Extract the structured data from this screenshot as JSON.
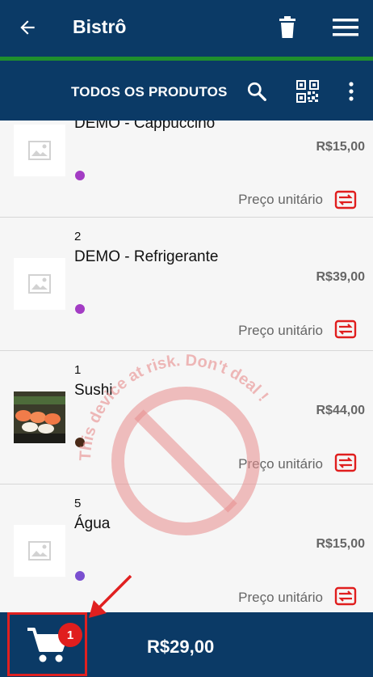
{
  "appbar": {
    "title": "Bistrô"
  },
  "subbar": {
    "label": "TODOS OS PRODUTOS"
  },
  "items": [
    {
      "qty": "",
      "name": "DEMO - Cappuccino",
      "price": "R$15,00",
      "unit_label": "Preço unitário",
      "dot_color": "#a33cc4",
      "thumb": "placeholder"
    },
    {
      "qty": "2",
      "name": "DEMO - Refrigerante",
      "price": "R$39,00",
      "unit_label": "Preço unitário",
      "dot_color": "#a33cc4",
      "thumb": "placeholder"
    },
    {
      "qty": "1",
      "name": "Sushi",
      "price": "R$44,00",
      "unit_label": "Preço unitário",
      "dot_color": "#4a2a18",
      "thumb": "sushi-photo"
    },
    {
      "qty": "5",
      "name": "Água",
      "price": "R$15,00",
      "unit_label": "Preço unitário",
      "dot_color": "#7a4fd0",
      "thumb": "placeholder"
    }
  ],
  "watermark": {
    "text": "This device at risk. Don't deal !"
  },
  "cart": {
    "badge": "1",
    "total": "R$29,00"
  },
  "colors": {
    "primary": "#0b3a66",
    "accent_green": "#1f8f2d",
    "alert_red": "#e01e1e"
  }
}
